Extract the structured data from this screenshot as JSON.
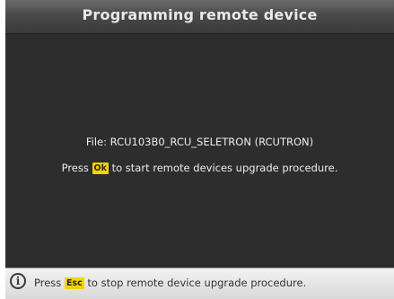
{
  "header": {
    "title": "Programming remote device"
  },
  "main": {
    "file_line": "File: RCU103B0_RCU_SELETRON (RCUTRON)",
    "press_prefix": "Press",
    "ok_key": "Ok",
    "press_suffix": "to start remote devices upgrade procedure."
  },
  "footer": {
    "info_icon": "info-icon",
    "prefix": "Press",
    "esc_key": "Esc",
    "suffix": "to stop remote device upgrade procedure."
  },
  "colors": {
    "background": "#2d2d2d",
    "key_highlight": "#f2d400",
    "footer_bg": "#e4e4e4"
  }
}
